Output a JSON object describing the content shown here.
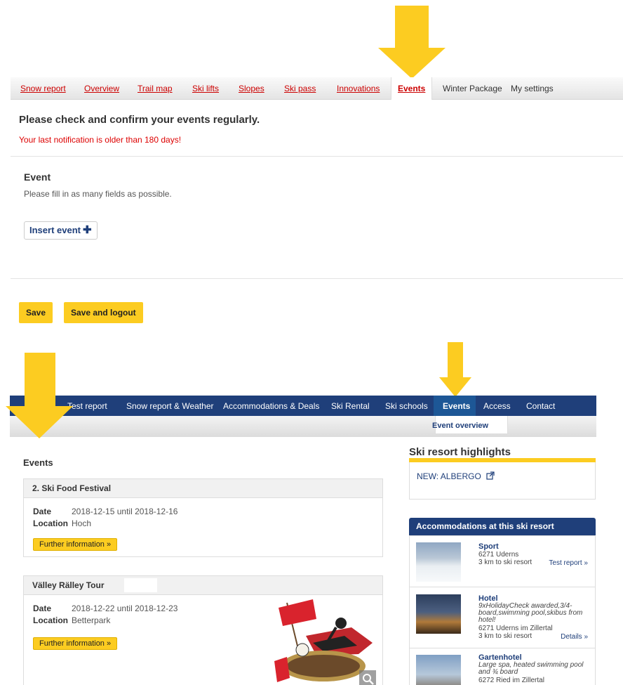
{
  "colors": {
    "accent_yellow": "#fccc21",
    "nav_blue": "#1f3f7a",
    "warning_red": "#dd0000"
  },
  "top": {
    "tabs": [
      {
        "label": "Snow report"
      },
      {
        "label": "Overview"
      },
      {
        "label": "Trail map"
      },
      {
        "label": "Ski lifts"
      },
      {
        "label": "Slopes"
      },
      {
        "label": "Ski pass"
      },
      {
        "label": "Innovations"
      },
      {
        "label": "Events"
      },
      {
        "label": "Winter Package"
      },
      {
        "label": "My settings"
      }
    ],
    "active_tab": "Events",
    "warning_title": "Please check and confirm your events regularly.",
    "warning_text": "Your last notification is older than 180 days!",
    "event_heading": "Event",
    "event_hint": "Please fill in as many fields as possible.",
    "insert_button": "Insert event",
    "insert_icon": "plus-icon",
    "save_button": "Save",
    "save_logout_button": "Save and logout"
  },
  "bottom": {
    "nav": [
      {
        "label": "Test report"
      },
      {
        "label": "Snow report & Weather"
      },
      {
        "label": "Accommodations & Deals"
      },
      {
        "label": "Ski Rental"
      },
      {
        "label": "Ski schools"
      },
      {
        "label": "Events"
      },
      {
        "label": "Access"
      },
      {
        "label": "Contact"
      }
    ],
    "active_nav": "Events",
    "subnav_item": "Event overview",
    "events_title": "Events",
    "events": [
      {
        "title": "2. Ski Food Festival",
        "date_label": "Date",
        "date": "2018-12-15 until 2018-12-16",
        "location_label": "Location",
        "location": "Hoch",
        "button": "Further information »"
      },
      {
        "title": "Välley Rälley Tour",
        "date_label": "Date",
        "date": "2018-12-22 until 2018-12-23",
        "location_label": "Location",
        "location": "Betterpark",
        "button": "Further information »"
      }
    ],
    "sidebar": {
      "highlights_title": "Ski resort highlights",
      "highlight_link": "NEW: ALBERGO",
      "accommodations_title": "Accommodations at this ski resort",
      "accommodations": [
        {
          "name": "Sport",
          "lines": [
            "6271 Uderns",
            "3 km to ski resort"
          ],
          "link": "Test report »"
        },
        {
          "name": "Hotel",
          "desc": "9xHolidayCheck awarded,3/4-board,swimming pool,skibus from hotel!",
          "lines": [
            "6271 Uderns im Zillertal",
            "3 km to ski resort"
          ],
          "link": "Details »"
        },
        {
          "name": "Gartenhotel",
          "desc": "Large spa, heated swimming pool and ¾ board",
          "lines": [
            "6272 Ried im Zillertal"
          ]
        }
      ]
    }
  }
}
